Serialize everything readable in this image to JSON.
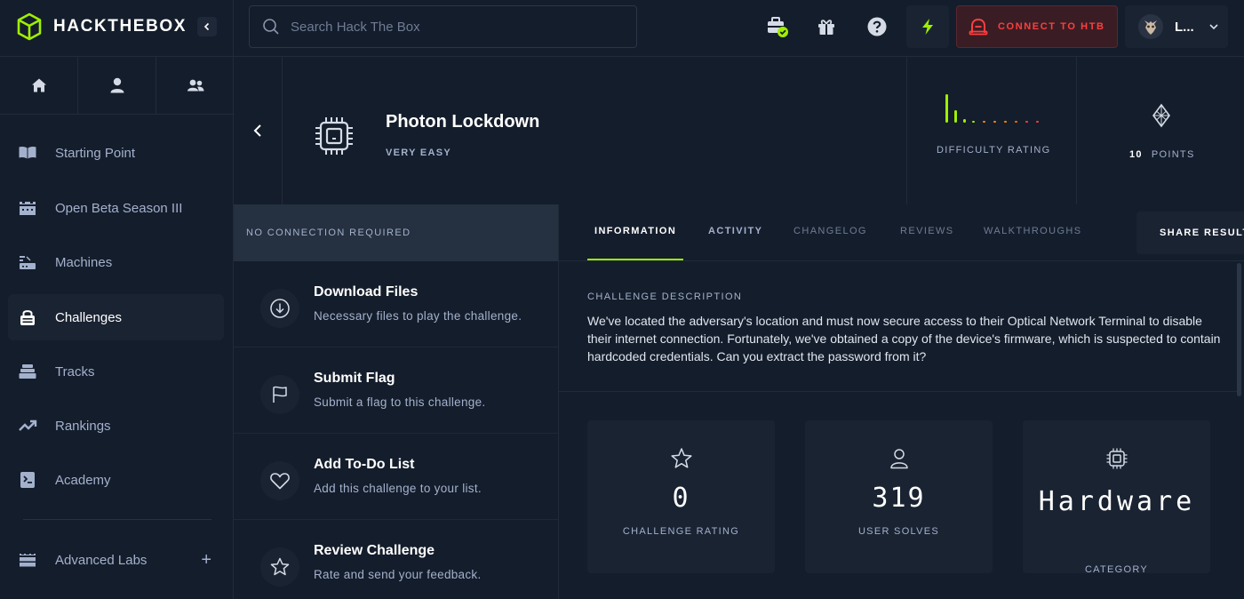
{
  "brand": {
    "name": "HACKTHEBOX",
    "accent": "#9fef00",
    "danger": "#ff3e3e"
  },
  "search": {
    "placeholder": "Search Hack The Box"
  },
  "topbar": {
    "connect_label": "CONNECT TO HTB",
    "user_label": "L...",
    "icons": [
      "toolbox-check-icon",
      "gift-icon",
      "help-icon",
      "bolt-icon",
      "vpn-icon",
      "avatar",
      "chevron-down-icon"
    ]
  },
  "sidebar": {
    "top_icons": [
      "home-icon",
      "user-icon",
      "team-icon"
    ],
    "items": [
      {
        "label": "Starting Point",
        "icon": "book-icon"
      },
      {
        "label": "Open Beta Season III",
        "icon": "castle-icon"
      },
      {
        "label": "Machines",
        "icon": "server-icon"
      },
      {
        "label": "Challenges",
        "icon": "lock-icon",
        "active": true
      },
      {
        "label": "Tracks",
        "icon": "layers-icon"
      },
      {
        "label": "Rankings",
        "icon": "trend-icon"
      },
      {
        "label": "Academy",
        "icon": "academy-icon"
      },
      {
        "label": "Advanced Labs",
        "icon": "labs-icon"
      }
    ]
  },
  "challenge": {
    "title": "Photon Lockdown",
    "difficulty": "VERY EASY",
    "difficulty_rating_label": "DIFFICULTY RATING",
    "points_value": "10",
    "points_label": "POINTS"
  },
  "actions_panel": {
    "connection_note": "NO CONNECTION REQUIRED",
    "items": [
      {
        "title": "Download Files",
        "subtitle": "Necessary files to play the challenge.",
        "icon": "download-icon"
      },
      {
        "title": "Submit Flag",
        "subtitle": "Submit a flag to this challenge.",
        "icon": "flag-icon"
      },
      {
        "title": "Add To-Do List",
        "subtitle": "Add this challenge to your list.",
        "icon": "heart-icon"
      },
      {
        "title": "Review Challenge",
        "subtitle": "Rate and send your feedback.",
        "icon": "star-icon"
      }
    ]
  },
  "tabs": {
    "items": [
      "INFORMATION",
      "ACTIVITY",
      "CHANGELOG",
      "REVIEWS",
      "WALKTHROUGHS"
    ],
    "active": "INFORMATION",
    "share_label": "SHARE RESULT"
  },
  "description": {
    "label": "CHALLENGE DESCRIPTION",
    "text": "We've located the adversary's location and must now secure access to their Optical Network Terminal to disable their internet connection. Fortunately, we've obtained a copy of the device's firmware, which is suspected to contain hardcoded credentials. Can you extract the password from it?"
  },
  "stats": [
    {
      "value": "0",
      "label": "CHALLENGE RATING",
      "icon": "star-outline-icon"
    },
    {
      "value": "319",
      "label": "USER SOLVES",
      "icon": "user-outline-icon"
    },
    {
      "value": "Hardware",
      "label": "CATEGORY",
      "icon": "chip-icon"
    }
  ]
}
